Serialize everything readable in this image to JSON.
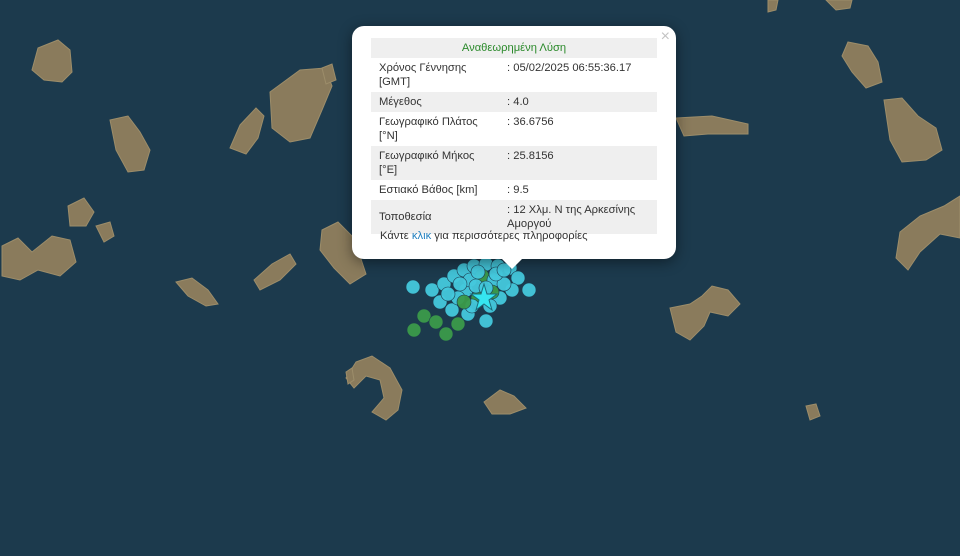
{
  "popup": {
    "title": "Αναθεωρημένη Λύση",
    "close_symbol": "×",
    "rows": [
      {
        "label": "Χρόνος Γέννησης [GMT]",
        "value": ": 05/02/2025 06:55:36.17"
      },
      {
        "label": "Μέγεθος",
        "value": ": 4.0"
      },
      {
        "label": "Γεωγραφικό Πλάτος [°N]",
        "value": ": 36.6756"
      },
      {
        "label": "Γεωγραφικό Μήκος [°E]",
        "value": ": 25.8156"
      },
      {
        "label": "Εστιακό Βάθος [km]",
        "value": ": 9.5"
      },
      {
        "label": "Τοποθεσία",
        "value": ": 12 Χλμ. Ν της Αρκεσίνης Αμοργού"
      }
    ],
    "more_prefix": "Κάντε",
    "more_link": "κλικ",
    "more_suffix": "για περισσότερες πληροφορίες"
  },
  "map": {
    "sea_color": "#1c3a4d",
    "land_color": "#8a7b5c",
    "marker_cyan": "#45c8dc",
    "marker_green": "#3b9a4a",
    "epicenter_icon": "star-icon",
    "epicenter_color": "#35e6f0"
  }
}
